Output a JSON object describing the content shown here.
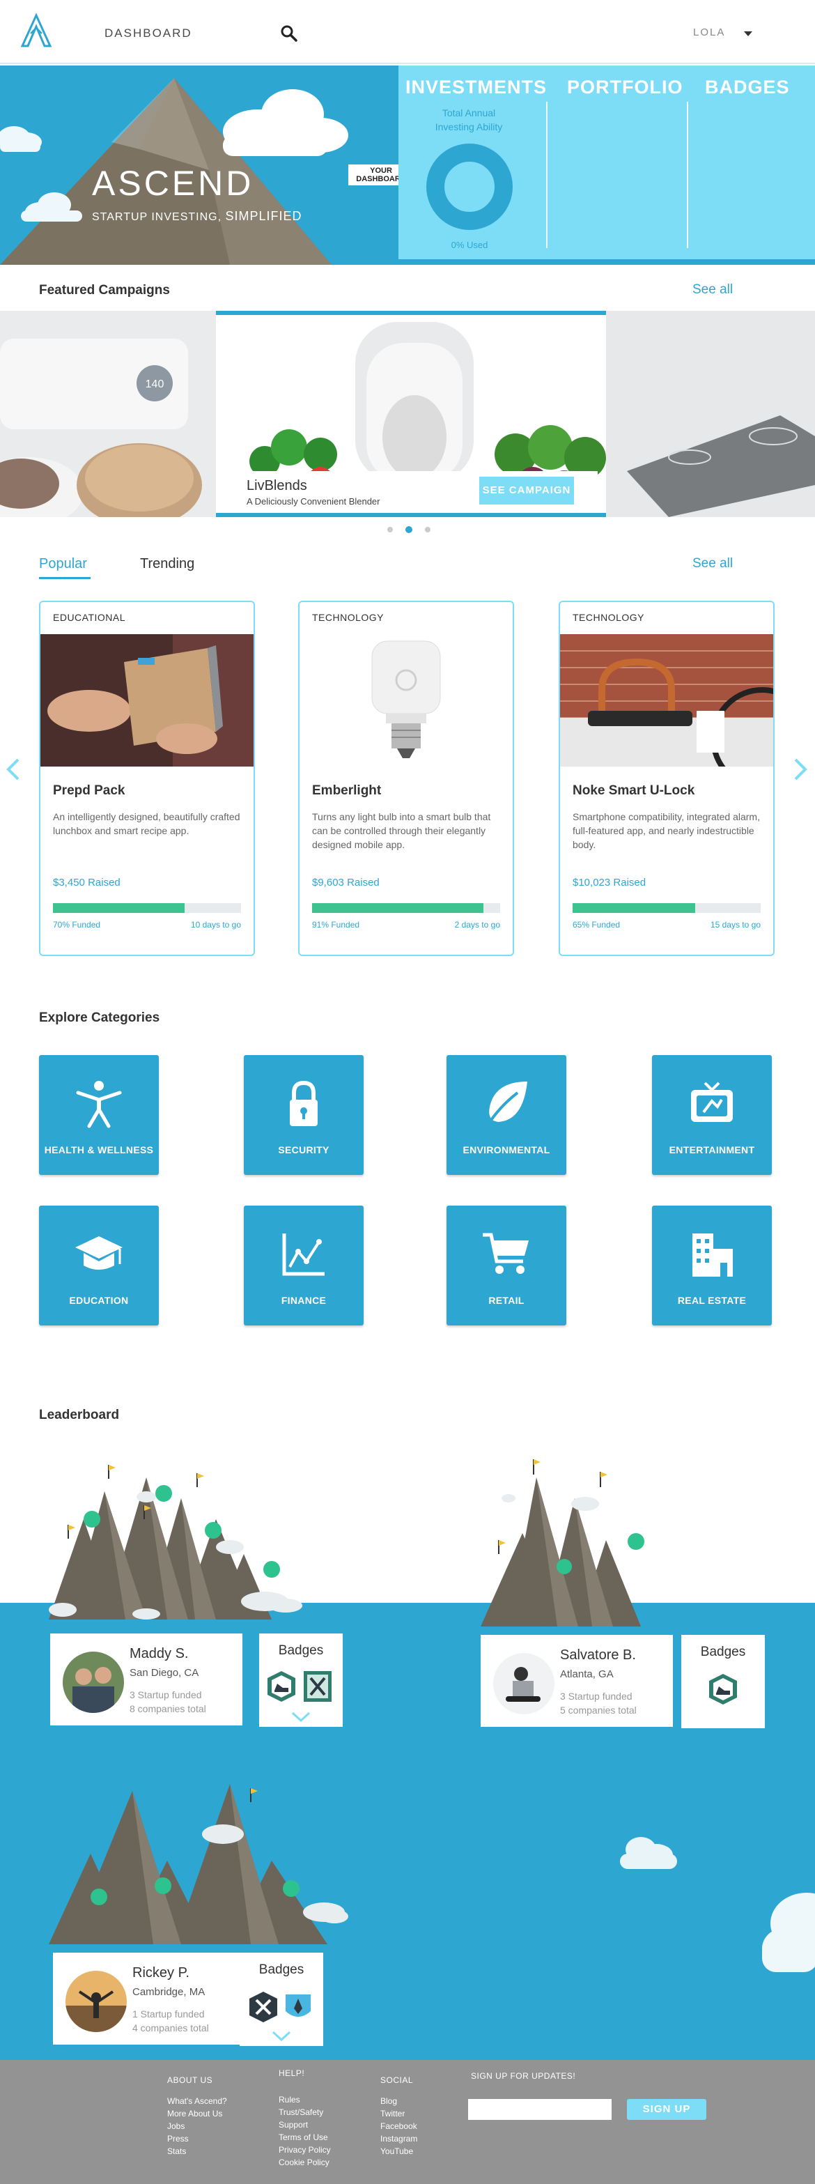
{
  "nav": {
    "title": "DASHBOARD",
    "user": "LOLA"
  },
  "hero": {
    "brand": "ASCEND",
    "subtitle_prefix": "STARTUP INVESTING,",
    "subtitle_strong": "SIMPLIFIED",
    "dashboard_tag_line1": "YOUR",
    "dashboard_tag_line2": "DASHBOARD",
    "panel": {
      "investments": "INVESTMENTS",
      "portfolio": "PORTFOLIO",
      "badges": "BADGES",
      "sub_line1": "Total Annual",
      "sub_line2": "Investing Ability",
      "used": "0% Used",
      "used_fraction": 0
    }
  },
  "featured": {
    "title": "Featured Campaigns",
    "see_all": "See all",
    "campaign_name": "LivBlends",
    "campaign_tagline": "A Deliciously Convenient Blender",
    "campaign_button": "SEE CAMPAIGN",
    "appliance_temp": "140",
    "active_dot": 1
  },
  "popular": {
    "tab_popular": "Popular",
    "tab_trending": "Trending",
    "see_all": "See all",
    "cards": [
      {
        "category": "EDUCATIONAL",
        "name": "Prepd Pack",
        "desc": "An intelligently designed, beautifully crafted lunchbox and smart recipe app.",
        "raised": "$3,450",
        "raised_label": "Raised",
        "funded": "70% Funded",
        "funded_pct": 70,
        "days": "10 days to go"
      },
      {
        "category": "TECHNOLOGY",
        "name": "Emberlight",
        "desc": "Turns any light bulb into a smart bulb that can be controlled through their elegantly designed mobile app.",
        "raised": "$9,603",
        "raised_label": "Raised",
        "funded": "91% Funded",
        "funded_pct": 91,
        "days": "2 days to go"
      },
      {
        "category": "TECHNOLOGY",
        "name": "Noke Smart U-Lock",
        "desc": "Smartphone compatibility, integrated alarm, full-featured app, and nearly indestructible body.",
        "raised": "$10,023",
        "raised_label": "Raised",
        "funded": "65% Funded",
        "funded_pct": 65,
        "days": "15 days to go"
      }
    ]
  },
  "categories": {
    "title": "Explore Categories",
    "items": [
      {
        "label": "HEALTH & WELLNESS",
        "icon": "person-icon"
      },
      {
        "label": "SECURITY",
        "icon": "lock-icon"
      },
      {
        "label": "ENVIRONMENTAL",
        "icon": "leaf-icon"
      },
      {
        "label": "ENTERTAINMENT",
        "icon": "tv-icon"
      },
      {
        "label": "EDUCATION",
        "icon": "graduation-cap-icon"
      },
      {
        "label": "FINANCE",
        "icon": "line-chart-icon"
      },
      {
        "label": "RETAIL",
        "icon": "cart-icon"
      },
      {
        "label": "REAL ESTATE",
        "icon": "building-icon"
      }
    ]
  },
  "leaderboard": {
    "title": "Leaderboard",
    "badges_label": "Badges",
    "leaders": [
      {
        "name": "Maddy S.",
        "location": "San Diego, CA",
        "stat1": "3 Startup funded",
        "stat2": "8 companies total"
      },
      {
        "name": "Salvatore B.",
        "location": "Atlanta, GA",
        "stat1": "3 Startup funded",
        "stat2": "5 companies total"
      },
      {
        "name": "Rickey P.",
        "location": "Cambridge, MA",
        "stat1": "1 Startup funded",
        "stat2": "4 companies total"
      }
    ]
  },
  "footer": {
    "about_head": "ABOUT US",
    "about_links": [
      "What's Ascend?",
      "More About Us",
      "Jobs",
      "Press",
      "Stats"
    ],
    "help_head": "HELP!",
    "help_links": [
      "Rules",
      "Trust/Safety",
      "Support",
      "Terms of Use",
      "Privacy Policy",
      "Cookie Policy"
    ],
    "social_head": "SOCIAL",
    "social_links": [
      "Blog",
      "Twitter",
      "Facebook",
      "Instagram",
      "YouTube"
    ],
    "signup_head": "SIGN UP FOR UPDATES!",
    "signup_button": "SIGN UP"
  },
  "colors": {
    "accent": "#2ea6d2",
    "accent_light": "#7ddcf6",
    "progress": "#3cc38f",
    "footer": "#939393",
    "mountain": "#6b6459"
  }
}
